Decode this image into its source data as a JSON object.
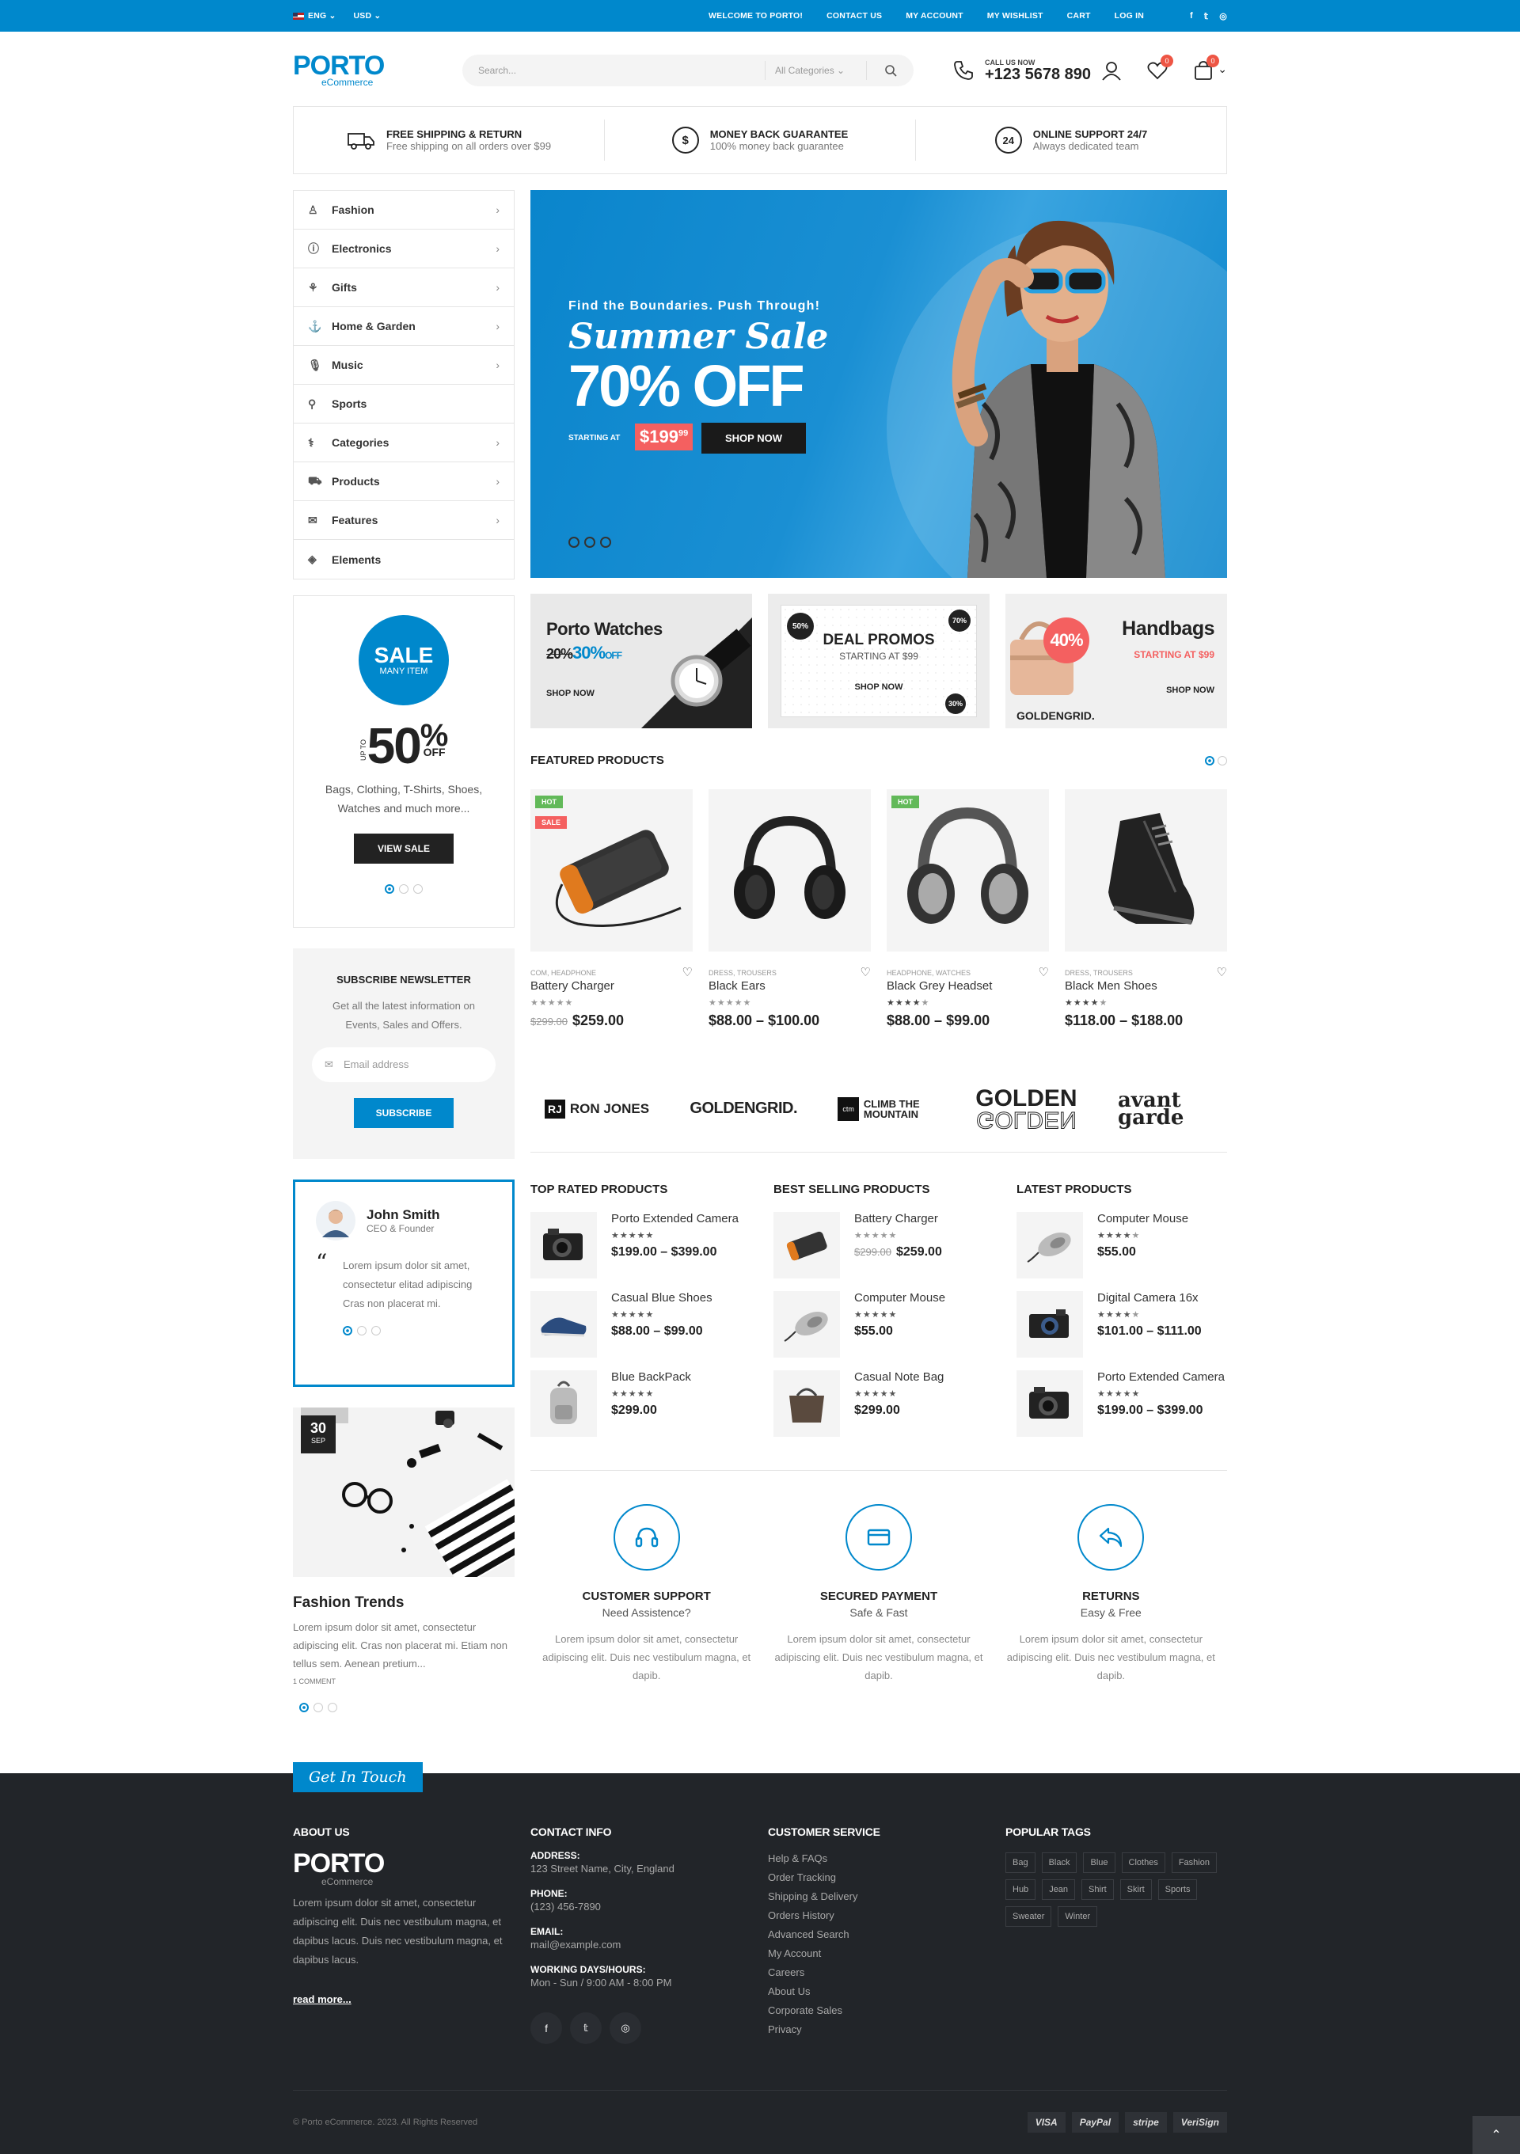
{
  "topbar": {
    "lang": "ENG",
    "currency": "USD",
    "links": [
      "WELCOME TO PORTO!",
      "CONTACT US",
      "MY ACCOUNT",
      "MY WISHLIST",
      "CART",
      "LOG IN"
    ]
  },
  "header": {
    "logo": "PORTO",
    "logo_sub": "eCommerce",
    "search_placeholder": "Search...",
    "search_category": "All Categories",
    "call_label": "CALL US NOW",
    "call_number": "+123 5678 890",
    "wishlist_count": "0",
    "cart_count": "0"
  },
  "info": [
    {
      "title": "FREE SHIPPING & RETURN",
      "desc": "Free shipping on all orders over $99"
    },
    {
      "title": "MONEY BACK GUARANTEE",
      "desc": "100% money back guarantee"
    },
    {
      "title": "ONLINE SUPPORT 24/7",
      "desc": "Always dedicated team",
      "icon": "24"
    }
  ],
  "categories": [
    {
      "label": "Fashion",
      "icon": "fashion-icon"
    },
    {
      "label": "Electronics",
      "icon": "electronics-icon"
    },
    {
      "label": "Gifts",
      "icon": "gift-icon"
    },
    {
      "label": "Home & Garden",
      "icon": "anchor-icon"
    },
    {
      "label": "Music",
      "icon": "microphone-icon"
    },
    {
      "label": "Sports",
      "icon": "sports-icon"
    },
    {
      "label": "Categories",
      "icon": "categories-icon"
    },
    {
      "label": "Products",
      "icon": "cart-icon"
    },
    {
      "label": "Features",
      "icon": "mail-icon"
    },
    {
      "label": "Elements",
      "icon": "layers-icon"
    }
  ],
  "hero": {
    "kicker": "Find the Boundaries. Push Through!",
    "title": "Summer Sale",
    "discount": "70% OFF",
    "starting": "STARTING AT",
    "price": "$199",
    "price_cents": "99",
    "button": "SHOP NOW"
  },
  "banners": {
    "watches_title": "Porto Watches",
    "watches_old": "20%",
    "watches_new": "30%",
    "watches_off": "OFF",
    "watches_btn": "SHOP NOW",
    "deal_title": "DEAL PROMOS",
    "deal_sub": "STARTING AT $99",
    "deal_btn": "SHOP NOW",
    "bag_badge": "40%",
    "bag_title": "Handbags",
    "bag_sub": "STARTING AT $99",
    "bag_btn": "SHOP NOW",
    "bag_brand": "GOLDENGRID."
  },
  "salebox": {
    "sale": "SALE",
    "sale_sub": "MANY ITEM",
    "up_to": "UP TO",
    "percent": "50",
    "percent_sign": "%",
    "off": "OFF",
    "desc1": "Bags, Clothing, T-Shirts, Shoes,",
    "desc2": "Watches and much more...",
    "button": "VIEW SALE"
  },
  "newsletter": {
    "title": "SUBSCRIBE NEWSLETTER",
    "desc1": "Get all the latest information on",
    "desc2": "Events, Sales and Offers.",
    "placeholder": "Email address",
    "button": "SUBSCRIBE"
  },
  "testimonial": {
    "name": "John Smith",
    "role": "CEO & Founder",
    "quote": "Lorem ipsum dolor sit amet, consectetur elitad adipiscing Cras non placerat mi."
  },
  "blog": {
    "day": "30",
    "month": "SEP",
    "title": "Fashion Trends",
    "excerpt": "Lorem ipsum dolor sit amet, consectetur adipiscing elit. Cras non placerat mi. Etiam non tellus sem. Aenean pretium...",
    "comments": "1 COMMENT"
  },
  "featured": {
    "title": "FEATURED PRODUCTS",
    "products": [
      {
        "cat": "COM, HEADPHONE",
        "name": "Battery Charger",
        "old": "$299.00",
        "price": "$259.00",
        "tags": [
          "HOT",
          "SALE"
        ]
      },
      {
        "cat": "DRESS, TROUSERS",
        "name": "Black Ears",
        "old": "",
        "price": "$88.00 – $100.00",
        "tags": []
      },
      {
        "cat": "HEADPHONE, WATCHES",
        "name": "Black Grey Headset",
        "old": "",
        "price": "$88.00 – $99.00",
        "tags": [
          "HOT"
        ]
      },
      {
        "cat": "DRESS, TROUSERS",
        "name": "Black Men Shoes",
        "old": "",
        "price": "$118.00 – $188.00",
        "tags": []
      }
    ]
  },
  "brands": [
    "RON JONES",
    "GOLDENGRID.",
    "CLIMB THE MOUNTAIN",
    "GOLDEN",
    "avant garde"
  ],
  "lists": [
    {
      "title": "TOP RATED PRODUCTS",
      "items": [
        {
          "name": "Porto Extended Camera",
          "old": "",
          "price": "$199.00 – $399.00"
        },
        {
          "name": "Casual Blue Shoes",
          "old": "",
          "price": "$88.00 – $99.00"
        },
        {
          "name": "Blue BackPack",
          "old": "",
          "price": "$299.00"
        }
      ]
    },
    {
      "title": "BEST SELLING PRODUCTS",
      "items": [
        {
          "name": "Battery Charger",
          "old": "$299.00",
          "price": "$259.00"
        },
        {
          "name": "Computer Mouse",
          "old": "",
          "price": "$55.00"
        },
        {
          "name": "Casual Note Bag",
          "old": "",
          "price": "$299.00"
        }
      ]
    },
    {
      "title": "LATEST PRODUCTS",
      "items": [
        {
          "name": "Computer Mouse",
          "old": "",
          "price": "$55.00"
        },
        {
          "name": "Digital Camera 16x",
          "old": "",
          "price": "$101.00 – $111.00"
        },
        {
          "name": "Porto Extended Camera",
          "old": "",
          "price": "$199.00 – $399.00"
        }
      ]
    }
  ],
  "services": [
    {
      "title": "CUSTOMER SUPPORT",
      "sub": "Need Assistence?",
      "desc": "Lorem ipsum dolor sit amet, consectetur adipiscing elit. Duis nec vestibulum magna, et dapib."
    },
    {
      "title": "SECURED PAYMENT",
      "sub": "Safe & Fast",
      "desc": "Lorem ipsum dolor sit amet, consectetur adipiscing elit. Duis nec vestibulum magna, et dapib."
    },
    {
      "title": "RETURNS",
      "sub": "Easy & Free",
      "desc": "Lorem ipsum dolor sit amet, consectetur adipiscing elit. Duis nec vestibulum magna, et dapib."
    }
  ],
  "footer": {
    "get_in_touch": "Get In Touch",
    "about_title": "ABOUT US",
    "about_text": "Lorem ipsum dolor sit amet, consectetur adipiscing elit. Duis nec vestibulum magna, et dapibus lacus. Duis nec vestibulum magna, et dapibus lacus.",
    "read_more": "read more...",
    "contact_title": "CONTACT INFO",
    "address_label": "ADDRESS:",
    "address": "123 Street Name, City, England",
    "phone_label": "PHONE:",
    "phone": "(123) 456-7890",
    "email_label": "EMAIL:",
    "email": "mail@example.com",
    "hours_label": "WORKING DAYS/HOURS:",
    "hours": "Mon - Sun / 9:00 AM - 8:00 PM",
    "service_title": "CUSTOMER SERVICE",
    "service_links": [
      "Help & FAQs",
      "Order Tracking",
      "Shipping & Delivery",
      "Orders History",
      "Advanced Search",
      "My Account",
      "Careers",
      "About Us",
      "Corporate Sales",
      "Privacy"
    ],
    "tags_title": "POPULAR TAGS",
    "tags": [
      "Bag",
      "Black",
      "Blue",
      "Clothes",
      "Fashion",
      "Hub",
      "Jean",
      "Shirt",
      "Skirt",
      "Sports",
      "Sweater",
      "Winter"
    ],
    "copyright": "© Porto eCommerce. 2023. All Rights Reserved",
    "payments": [
      "VISA",
      "PayPal",
      "stripe",
      "VeriSign"
    ]
  },
  "colors": {
    "accent": "#0088cc",
    "dark": "#222529",
    "sale": "#f46060",
    "hot": "#62b959"
  }
}
